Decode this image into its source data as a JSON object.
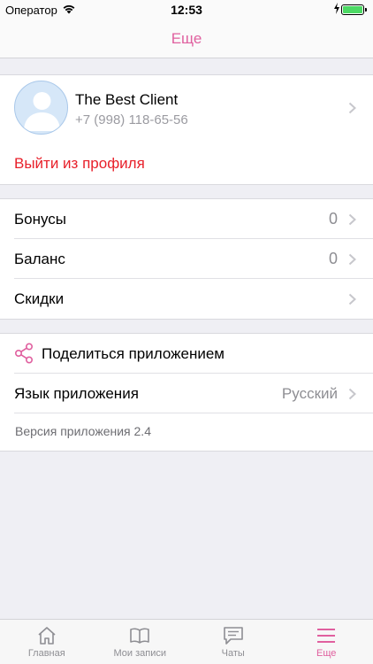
{
  "status_bar": {
    "carrier": "Оператор",
    "time": "12:53"
  },
  "nav": {
    "title": "Еще"
  },
  "profile": {
    "name": "The Best Client",
    "phone": "+7 (998) 118-65-56",
    "logout_label": "Выйти из профиля"
  },
  "loyalty": {
    "rows": [
      {
        "label": "Бонусы",
        "value": "0"
      },
      {
        "label": "Баланс",
        "value": "0"
      },
      {
        "label": "Скидки",
        "value": ""
      }
    ]
  },
  "settings": {
    "share_label": "Поделиться приложением",
    "language_label": "Язык приложения",
    "language_value": "Русский",
    "version": "Версия приложения 2.4"
  },
  "tabs": [
    {
      "label": "Главная",
      "icon": "home-icon"
    },
    {
      "label": "Мои записи",
      "icon": "book-icon"
    },
    {
      "label": "Чаты",
      "icon": "chat-icon"
    },
    {
      "label": "Еще",
      "icon": "menu-icon",
      "active": true
    }
  ],
  "colors": {
    "accent": "#e0609f",
    "danger": "#e8202a",
    "battery": "#4cd964"
  }
}
